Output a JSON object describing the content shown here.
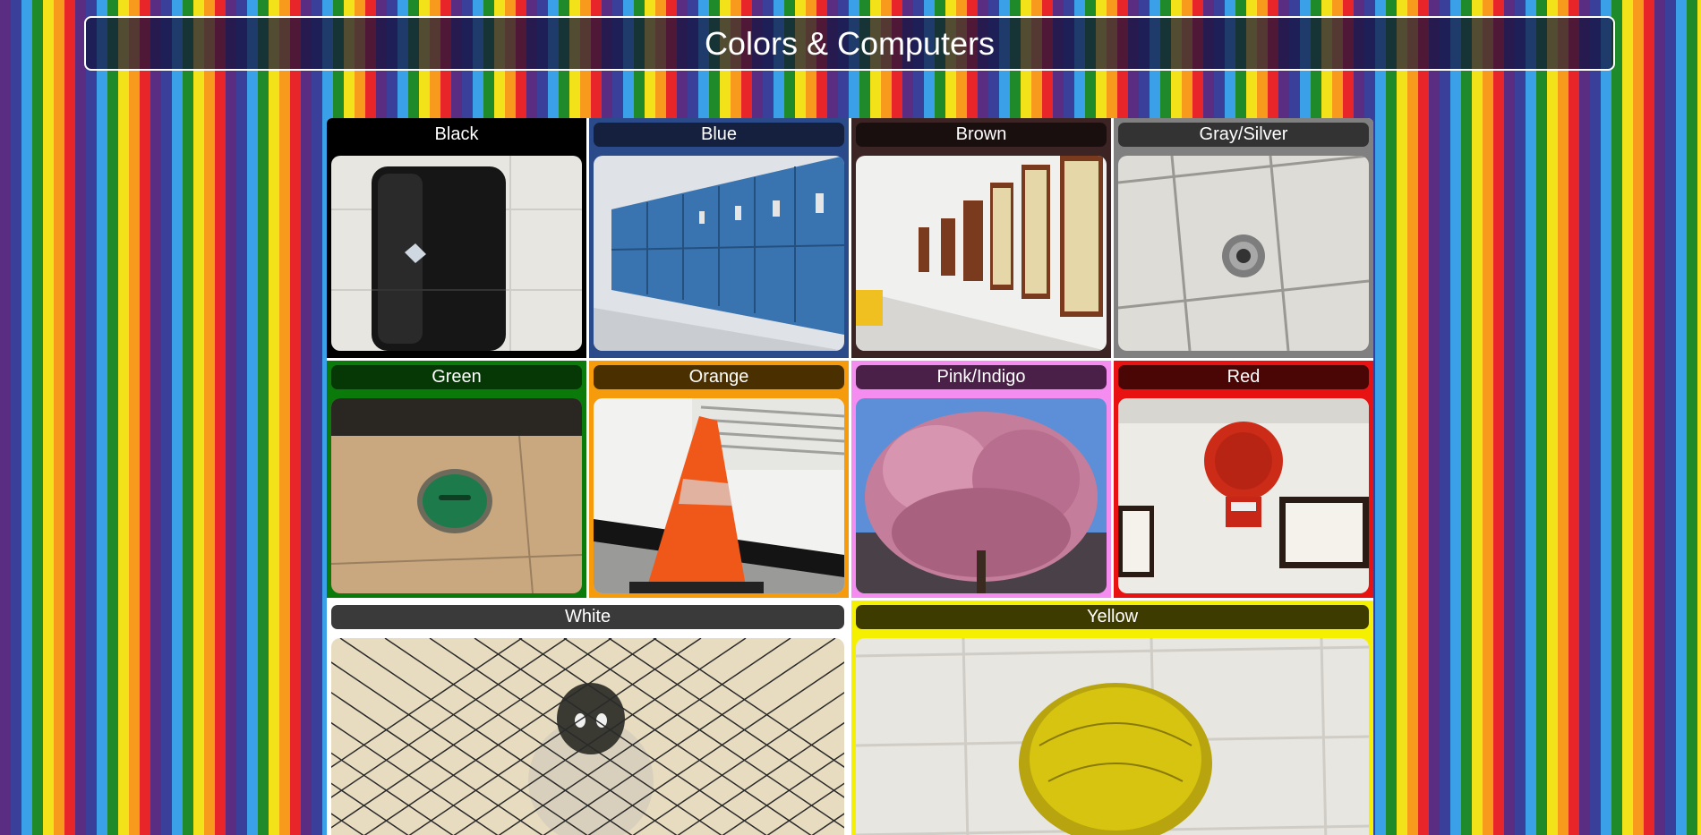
{
  "page": {
    "title": "Colors & Computers"
  },
  "tiles": [
    {
      "label": "Black",
      "bg": "#000000",
      "label_bg": "#000000"
    },
    {
      "label": "Blue",
      "bg": "#2b4a8a",
      "label_bg": "#14203e"
    },
    {
      "label": "Brown",
      "bg": "#3c2424",
      "label_bg": "#1a0f0f"
    },
    {
      "label": "Gray/Silver",
      "bg": "#808080",
      "label_bg": "#333333"
    },
    {
      "label": "Green",
      "bg": "#0a7a0a",
      "label_bg": "#053805"
    },
    {
      "label": "Orange",
      "bg": "#f59b0c",
      "label_bg": "#4a3000"
    },
    {
      "label": "Pink/Indigo",
      "bg": "#f58cf0",
      "label_bg": "#4a1f48"
    },
    {
      "label": "Red",
      "bg": "#e81212",
      "label_bg": "#4a0505"
    },
    {
      "label": "White",
      "bg": "#ffffff",
      "label_bg": "#3a3a3a"
    },
    {
      "label": "Yellow",
      "bg": "#f5f000",
      "label_bg": "#3d3b00"
    }
  ]
}
